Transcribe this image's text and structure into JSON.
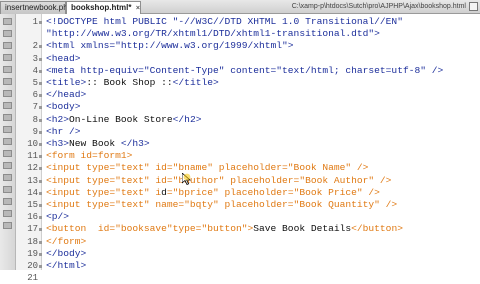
{
  "tabs": [
    {
      "label": "insertnewbook.php",
      "active": false
    },
    {
      "label": "bookshop.html*",
      "active": true
    }
  ],
  "file_path": "C:\\xamp-p\\htdocs\\Sutch\\pro\\AJPHP\\Ajax\\bookshop.html",
  "code_lines": [
    {
      "num": "1",
      "parts": [
        {
          "t": "<!DOCTYPE html PUBLIC \"-//W3C//DTD XHTML 1.0 Transitional//EN\"",
          "c": "blue"
        }
      ]
    },
    {
      "num": "",
      "parts": [
        {
          "t": "\"http://www.w3.org/TR/xhtml1/DTD/xhtml1-transitional.dtd\">",
          "c": "blue"
        }
      ]
    },
    {
      "num": "2",
      "parts": [
        {
          "t": "<html xmlns=\"http://www.w3.org/1999/xhtml\">",
          "c": "blue"
        }
      ]
    },
    {
      "num": "3",
      "parts": [
        {
          "t": "<head>",
          "c": "blue"
        }
      ]
    },
    {
      "num": "4",
      "parts": [
        {
          "t": "<meta http-equiv=\"Content-Type\" content=\"text/html; charset=utf-8\" />",
          "c": "blue"
        }
      ]
    },
    {
      "num": "5",
      "parts": [
        {
          "t": "<title>",
          "c": "blue"
        },
        {
          "t": ":: Book Shop ::",
          "c": "black"
        },
        {
          "t": "</title>",
          "c": "blue"
        }
      ]
    },
    {
      "num": "6",
      "parts": [
        {
          "t": "</head>",
          "c": "blue"
        }
      ]
    },
    {
      "num": "7",
      "parts": [
        {
          "t": "<body>",
          "c": "blue"
        }
      ]
    },
    {
      "num": "8",
      "parts": [
        {
          "t": "<h2>",
          "c": "blue"
        },
        {
          "t": "On-Line Book Store",
          "c": "black"
        },
        {
          "t": "</h2>",
          "c": "blue"
        }
      ]
    },
    {
      "num": "9",
      "parts": [
        {
          "t": "<hr />",
          "c": "blue"
        }
      ]
    },
    {
      "num": "10",
      "parts": [
        {
          "t": "<h3>",
          "c": "blue"
        },
        {
          "t": "New Book ",
          "c": "black"
        },
        {
          "t": "</h3>",
          "c": "blue"
        }
      ]
    },
    {
      "num": "11",
      "parts": [
        {
          "t": "<form id=form1>",
          "c": "orange"
        }
      ]
    },
    {
      "num": "12",
      "parts": [
        {
          "t": "<input type=\"text\" id=\"bname\" placeholder=\"Book Name\" />",
          "c": "orange"
        }
      ]
    },
    {
      "num": "13",
      "parts": [
        {
          "t": "<input type=\"text\" id=\"bauthor\" placeholder=\"Book Author\" />",
          "c": "orange"
        }
      ]
    },
    {
      "num": "14",
      "parts": [
        {
          "t": "<input type=\"text\" i",
          "c": "orange"
        },
        {
          "t": "d",
          "c": "black"
        },
        {
          "t": "=\"bprice\" placeholder=\"Book Price\" />",
          "c": "orange"
        }
      ]
    },
    {
      "num": "15",
      "parts": [
        {
          "t": "<input type=\"text\" name=\"bqty\" placeholder=\"Book Quantity\" />",
          "c": "orange"
        }
      ]
    },
    {
      "num": "16",
      "parts": [
        {
          "t": "<p/>",
          "c": "blue"
        }
      ]
    },
    {
      "num": "17",
      "parts": [
        {
          "t": "<button  id=\"booksave\"type=\"button\">",
          "c": "orange"
        },
        {
          "t": "Save Book Details",
          "c": "black"
        },
        {
          "t": "</button>",
          "c": "orange"
        }
      ]
    },
    {
      "num": "18",
      "parts": [
        {
          "t": "</form>",
          "c": "orange"
        }
      ]
    },
    {
      "num": "19",
      "parts": [
        {
          "t": "</body>",
          "c": "blue"
        }
      ]
    },
    {
      "num": "20",
      "parts": [
        {
          "t": "</html>",
          "c": "blue"
        }
      ]
    },
    {
      "num": "21",
      "parts": []
    }
  ],
  "colors": {
    "blue": "#1d2f9b",
    "orange": "#e07a14",
    "black": "#111111"
  },
  "icons": {
    "tab_close": "×",
    "restore": "restore-window-icon"
  }
}
